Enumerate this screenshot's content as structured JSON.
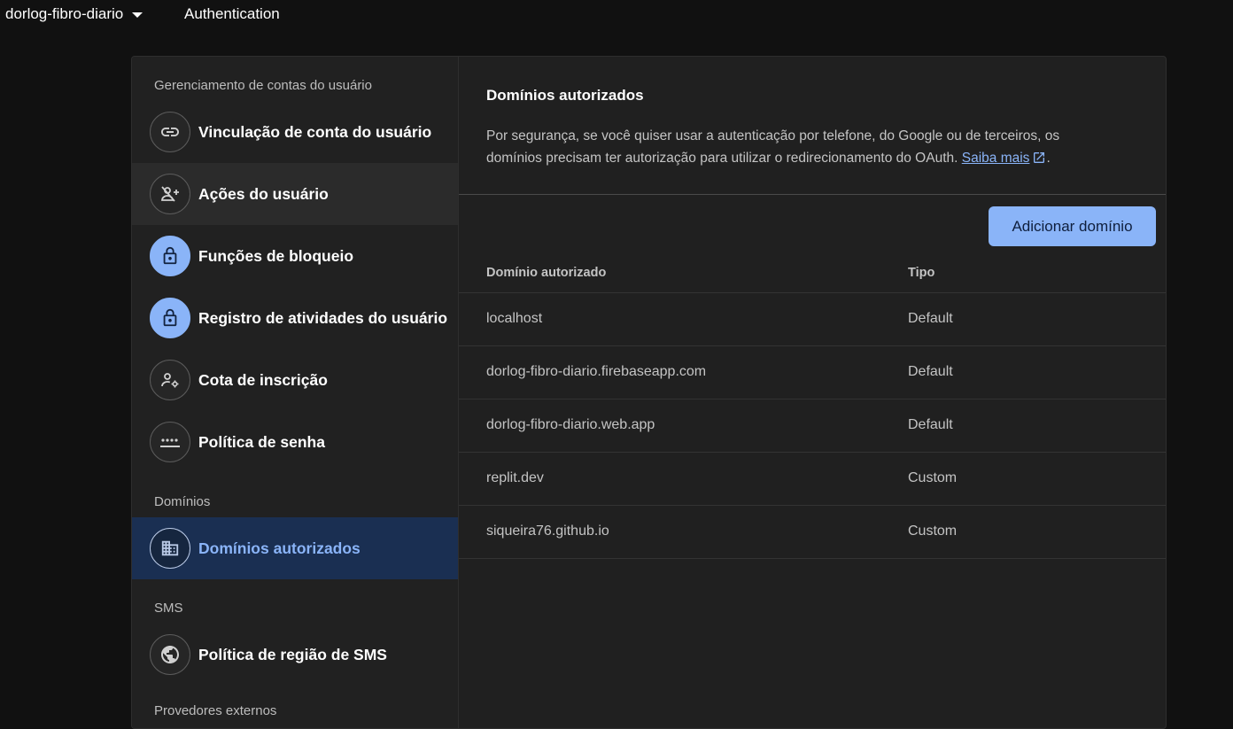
{
  "topbar": {
    "project_name": "dorlog-fibro-diario",
    "section_title": "Authentication"
  },
  "sidebar": {
    "group_user_accounts": "Gerenciamento de contas do usuário",
    "items": [
      {
        "label": "Vinculação de conta do usuário",
        "icon": "link-icon"
      },
      {
        "label": "Ações do usuário",
        "icon": "person-off-icon"
      },
      {
        "label": "Funções de bloqueio",
        "icon": "lock-icon"
      },
      {
        "label": "Registro de atividades do usuário",
        "icon": "lock-icon"
      },
      {
        "label": "Cota de inscrição",
        "icon": "person-settings-icon"
      },
      {
        "label": "Política de senha",
        "icon": "password-icon"
      }
    ],
    "group_domains": "Domínios",
    "domains_item": {
      "label": "Domínios autorizados",
      "icon": "building-icon"
    },
    "group_sms": "SMS",
    "sms_item": {
      "label": "Política de região de SMS",
      "icon": "globe-icon"
    },
    "group_partial": "Provedores externos"
  },
  "main": {
    "title": "Domínios autorizados",
    "description": "Por segurança, se você quiser usar a autenticação por telefone, do Google ou de terceiros, os domínios precisam ter autorização para utilizar o redirecionamento do OAuth.",
    "learn_more": "Saiba mais",
    "add_button": "Adicionar domínio",
    "columns": [
      "Domínio autorizado",
      "Tipo"
    ],
    "rows": [
      {
        "domain": "localhost",
        "type": "Default"
      },
      {
        "domain": "dorlog-fibro-diario.firebaseapp.com",
        "type": "Default"
      },
      {
        "domain": "dorlog-fibro-diario.web.app",
        "type": "Default"
      },
      {
        "domain": "replit.dev",
        "type": "Custom"
      },
      {
        "domain": "siqueira76.github.io",
        "type": "Custom"
      }
    ]
  },
  "colors": {
    "accent": "#8ab4f8",
    "active_bg": "#1a2f52",
    "background": "#111111",
    "card": "#202020"
  }
}
